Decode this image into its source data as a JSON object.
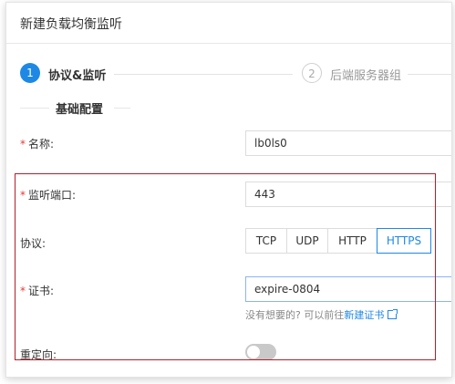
{
  "dialog": {
    "title": "新建负载均衡监听"
  },
  "steps": [
    {
      "number": "1",
      "label": "协议&监听"
    },
    {
      "number": "2",
      "label": "后端服务器组"
    }
  ],
  "section": {
    "title": "基础配置"
  },
  "form": {
    "required_mark": "*",
    "name": {
      "label": "名称:",
      "value": "lb0ls0"
    },
    "port": {
      "label": "监听端口:",
      "value": "443"
    },
    "protocol": {
      "label": "协议:",
      "options": [
        "TCP",
        "UDP",
        "HTTP",
        "HTTPS"
      ],
      "selected": "HTTPS"
    },
    "certificate": {
      "label": "证书:",
      "value": "expire-0804",
      "hint_prefix": "没有想要的? 可以前往",
      "hint_link": "新建证书"
    },
    "redirect": {
      "label": "重定向:",
      "enabled": false
    }
  },
  "colors": {
    "primary": "#1e88e5",
    "required": "#e53935",
    "highlight": "#b0202a"
  }
}
